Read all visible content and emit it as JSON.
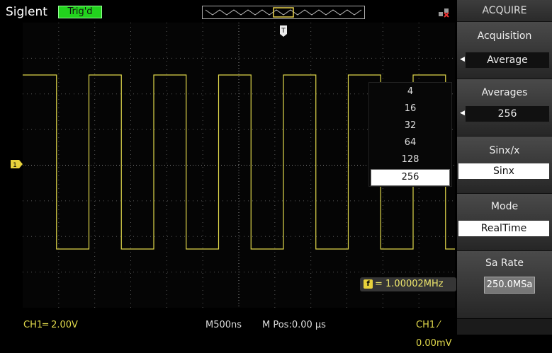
{
  "header": {
    "brand": "Siglent",
    "trigger_status": "Trig'd"
  },
  "acquire_menu": {
    "title": "ACQUIRE",
    "acquisition": {
      "label": "Acquisition",
      "value": "Average"
    },
    "averages": {
      "label": "Averages",
      "value": "256"
    },
    "sinx": {
      "label": "Sinx/x",
      "value": "Sinx"
    },
    "mode": {
      "label": "Mode",
      "value": "RealTime"
    },
    "sa_rate": {
      "label": "Sa Rate",
      "value": "250.0MSa"
    }
  },
  "averages_dropdown": {
    "options": [
      "4",
      "16",
      "32",
      "64",
      "128",
      "256"
    ],
    "selected": "256"
  },
  "measurement": {
    "frequency": "= 1.00002MHz",
    "icon": "f"
  },
  "status_bar": {
    "ch1_scale": "CH1═ 2.00V",
    "timebase": "M500ns",
    "mpos": "M Pos:0.00 µs",
    "trigger": "CH1 ⁄ 0.00mV"
  },
  "colors": {
    "trace": "#e0d84b",
    "trig_badge": "#22d31d",
    "grid": "#4a4a4a"
  }
}
